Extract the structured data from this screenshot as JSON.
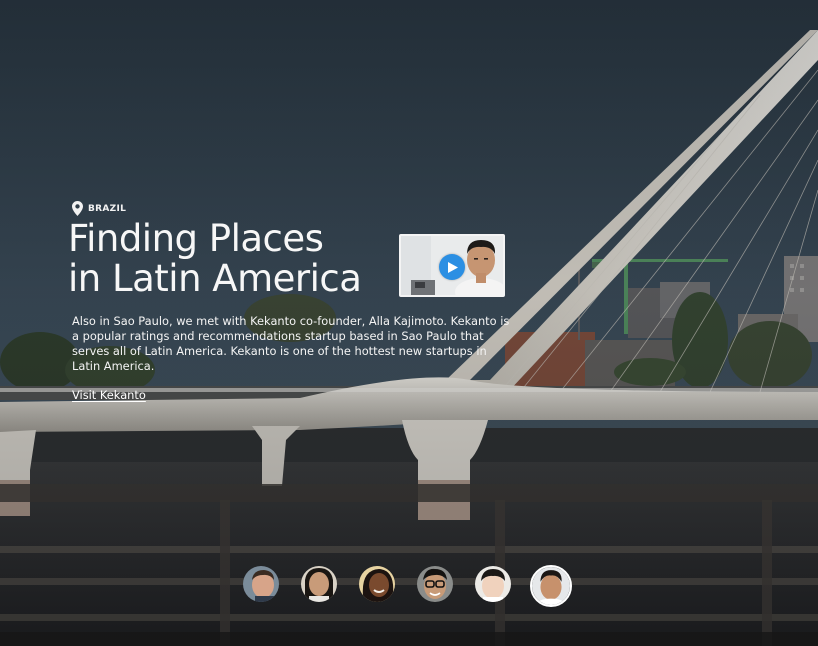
{
  "story": {
    "location": "BRAZIL",
    "title_line1": "Finding Places",
    "title_line2": "in Latin America",
    "description": "Also in Sao Paulo, we met with Kekanto co-founder, Alla Kajimoto. Kekanto is a popular ratings and recommendations startup based in Sao Paulo that serves all of Latin America. Kekanto is one of the hottest new startups in Latin America.",
    "link_label": "Visit Kekanto"
  },
  "video": {
    "icon": "play-icon",
    "accent": "#2b8fe3"
  },
  "people": [
    {
      "id": "person-1",
      "icon": "avatar-man",
      "active": false
    },
    {
      "id": "person-2",
      "icon": "avatar-woman",
      "active": false
    },
    {
      "id": "person-3",
      "icon": "avatar-woman-smiling",
      "active": false
    },
    {
      "id": "person-4",
      "icon": "avatar-man-glasses",
      "active": false
    },
    {
      "id": "person-5",
      "icon": "avatar-man-light",
      "active": false
    },
    {
      "id": "person-6",
      "icon": "avatar-man-kekanto",
      "active": true
    }
  ],
  "colors": {
    "sky": "#2b3743",
    "text": "#f4f4f4",
    "bridge": "#d8d4cc",
    "water": "#252629"
  }
}
